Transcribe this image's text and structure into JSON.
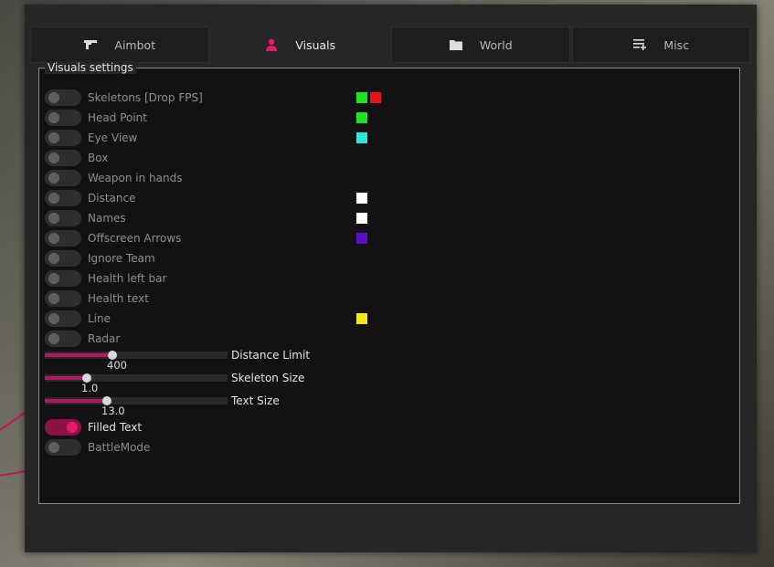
{
  "tabs": [
    {
      "label": "Aimbot",
      "icon": "gun-icon",
      "active": false
    },
    {
      "label": "Visuals",
      "icon": "person-icon",
      "active": true
    },
    {
      "label": "World",
      "icon": "folder-icon",
      "active": false
    },
    {
      "label": "Misc",
      "icon": "playlist-add-icon",
      "active": false
    }
  ],
  "group_title": "Visuals settings",
  "toggles": [
    {
      "label": "Skeletons [Drop FPS]",
      "on": false,
      "colors": [
        "#1ee31e",
        "#e81414"
      ]
    },
    {
      "label": "Head Point",
      "on": false,
      "colors": [
        "#1ee31e"
      ]
    },
    {
      "label": "Eye View",
      "on": false,
      "colors": [
        "#2ee6d6"
      ]
    },
    {
      "label": "Box",
      "on": false,
      "colors": []
    },
    {
      "label": "Weapon in hands",
      "on": false,
      "colors": []
    },
    {
      "label": "Distance",
      "on": false,
      "colors": [
        "#ffffff"
      ]
    },
    {
      "label": "Names",
      "on": false,
      "colors": [
        "#ffffff"
      ]
    },
    {
      "label": "Offscreen Arrows",
      "on": false,
      "colors": [
        "#5b10c8"
      ]
    },
    {
      "label": "Ignore Team",
      "on": false,
      "colors": []
    },
    {
      "label": "Health left bar",
      "on": false,
      "colors": []
    },
    {
      "label": "Health text",
      "on": false,
      "colors": []
    },
    {
      "label": "Line",
      "on": false,
      "colors": [
        "#f2e51a"
      ]
    },
    {
      "label": "Radar",
      "on": false,
      "colors": []
    }
  ],
  "sliders": [
    {
      "label": "Distance Limit",
      "value": "400",
      "fraction": 0.37
    },
    {
      "label": "Skeleton Size",
      "value": "1.0",
      "fraction": 0.23
    },
    {
      "label": "Text Size",
      "value": "13.0",
      "fraction": 0.34
    }
  ],
  "bottom_toggles": [
    {
      "label": "Filled Text",
      "on": true
    },
    {
      "label": "BattleMode",
      "on": false
    }
  ],
  "colors": {
    "accent": "#e8196d",
    "window": "#262626",
    "panel": "#121212"
  }
}
